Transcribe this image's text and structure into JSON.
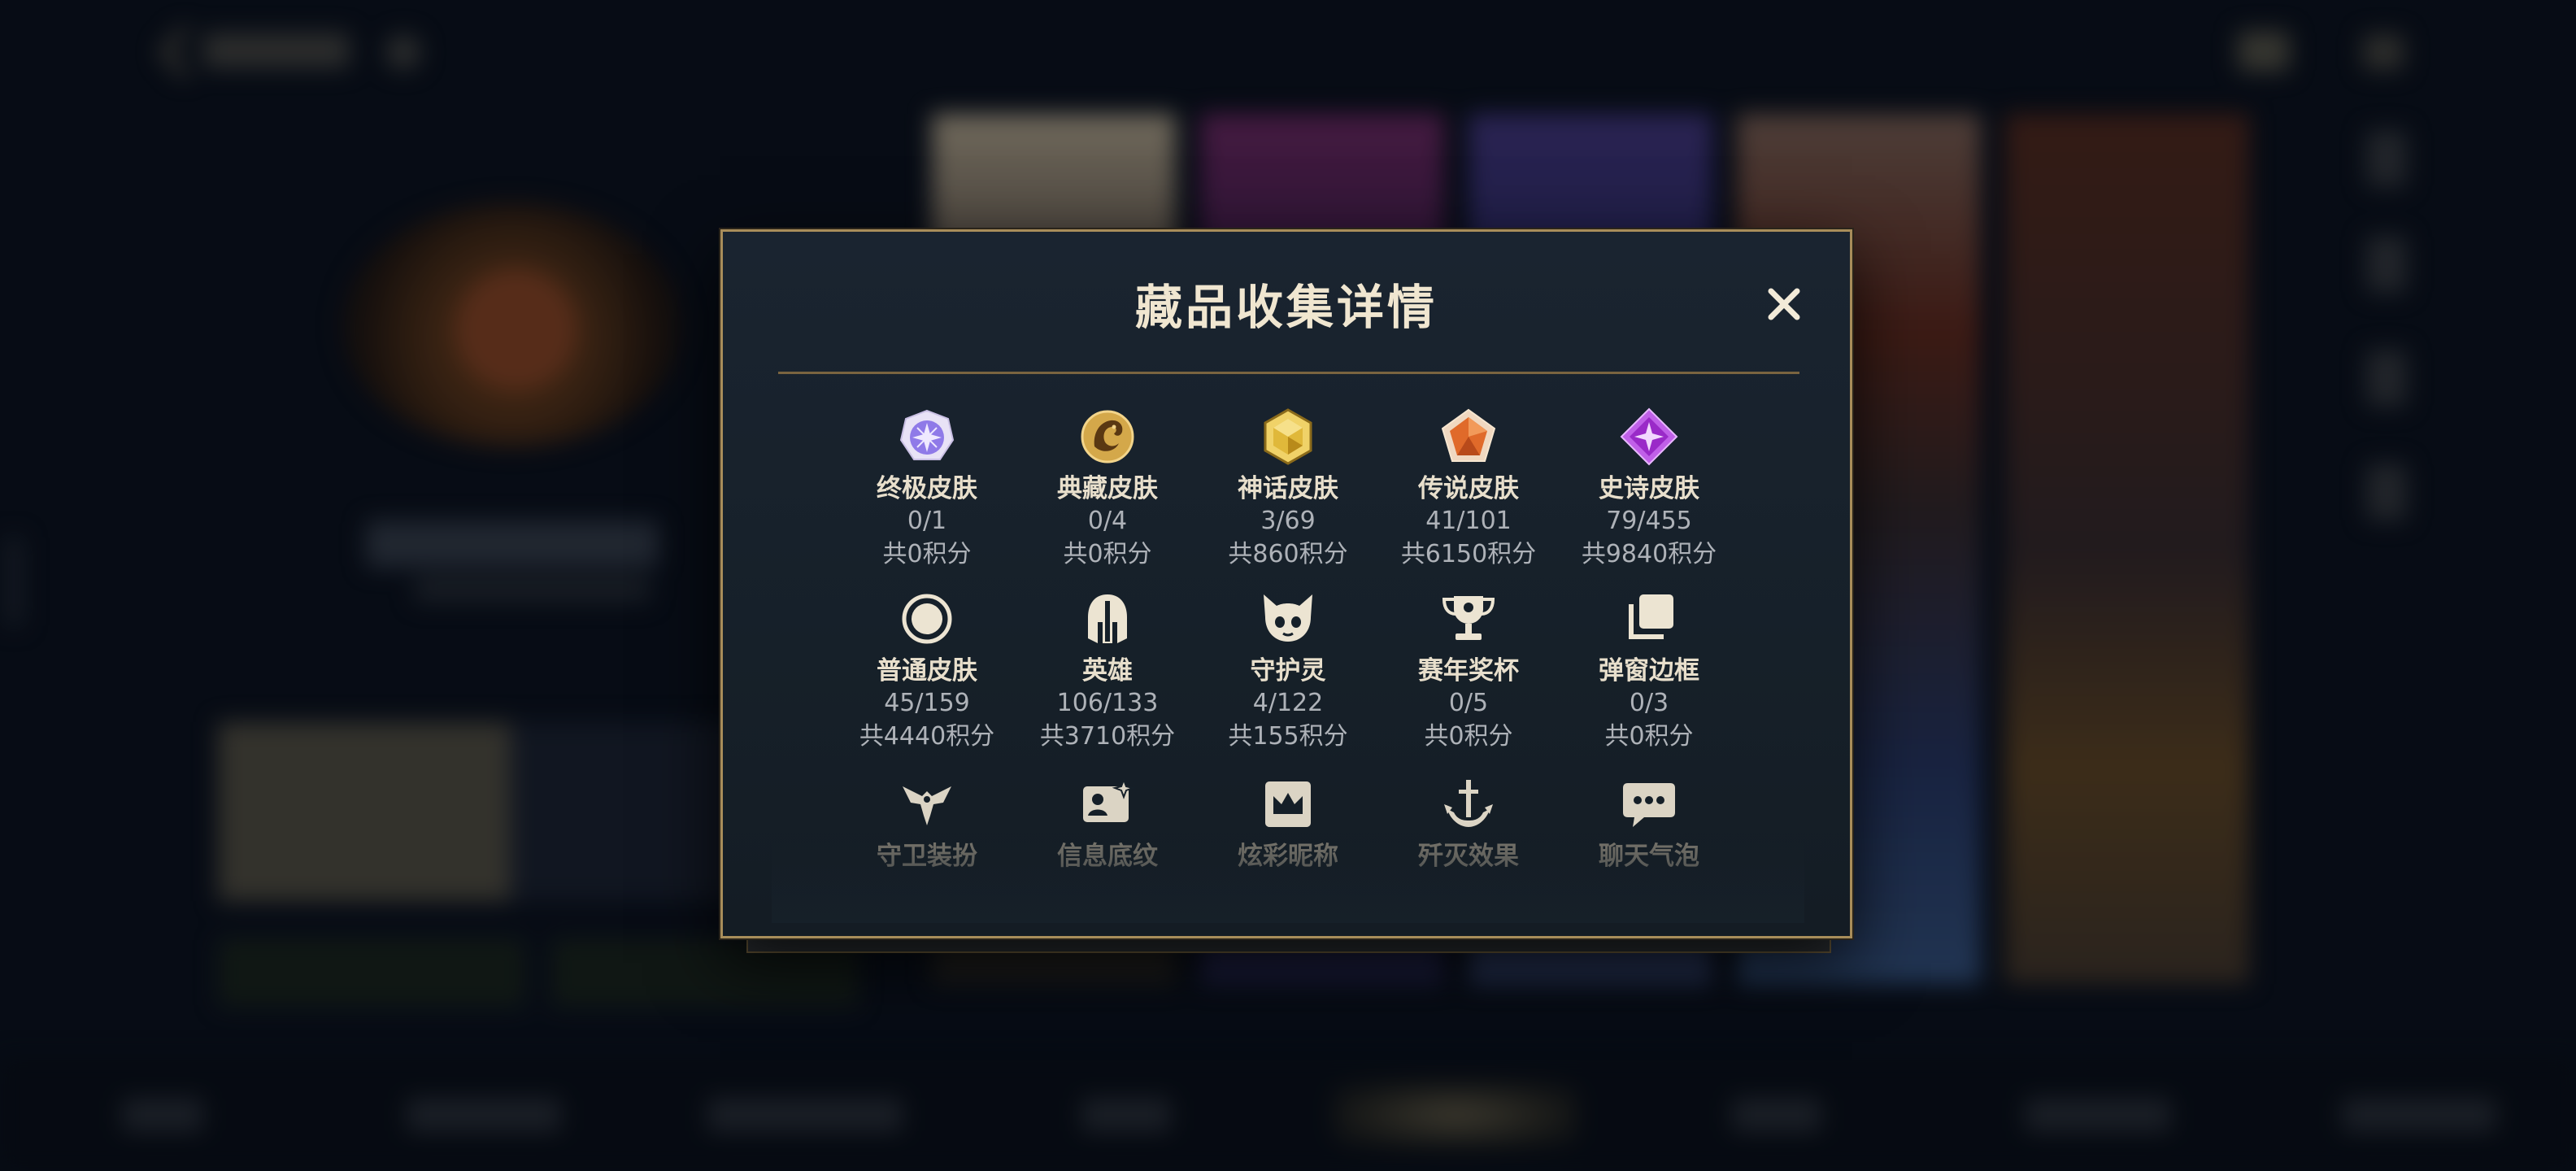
{
  "modal": {
    "title": "藏品收集详情",
    "close_label": "✕"
  },
  "collection_rows": [
    [
      {
        "label": "终极皮肤",
        "count": "0/1",
        "points": "共0积分",
        "icon": "ultimate-skin-icon",
        "color": "#8f7ae8"
      },
      {
        "label": "典藏皮肤",
        "count": "0/4",
        "points": "共0积分",
        "icon": "legacy-skin-icon",
        "color": "#d4a84a"
      },
      {
        "label": "神话皮肤",
        "count": "3/69",
        "points": "共860积分",
        "icon": "mythic-skin-icon",
        "color": "#e0b83a"
      },
      {
        "label": "传说皮肤",
        "count": "41/101",
        "points": "共6150积分",
        "icon": "legendary-skin-icon",
        "color": "#e06a2a"
      },
      {
        "label": "史诗皮肤",
        "count": "79/455",
        "points": "共9840积分",
        "icon": "epic-skin-icon",
        "color": "#b040d8"
      }
    ],
    [
      {
        "label": "普通皮肤",
        "count": "45/159",
        "points": "共4440积分",
        "icon": "normal-skin-icon",
        "color": "#e8dfcc"
      },
      {
        "label": "英雄",
        "count": "106/133",
        "points": "共3710积分",
        "icon": "hero-icon",
        "color": "#e8dfcc"
      },
      {
        "label": "守护灵",
        "count": "4/122",
        "points": "共155积分",
        "icon": "guardian-spirit-icon",
        "color": "#e8dfcc"
      },
      {
        "label": "赛年奖杯",
        "count": "0/5",
        "points": "共0积分",
        "icon": "season-trophy-icon",
        "color": "#e8dfcc"
      },
      {
        "label": "弹窗边框",
        "count": "0/3",
        "points": "共0积分",
        "icon": "popup-frame-icon",
        "color": "#e8dfcc"
      }
    ],
    [
      {
        "label": "守卫装扮",
        "icon": "ward-skin-icon"
      },
      {
        "label": "信息底纹",
        "icon": "info-background-icon"
      },
      {
        "label": "炫彩昵称",
        "icon": "colorful-nickname-icon"
      },
      {
        "label": "歼灭效果",
        "icon": "annihilation-effect-icon"
      },
      {
        "label": "聊天气泡",
        "icon": "chat-bubble-icon"
      }
    ]
  ],
  "colors": {
    "modal_border": "#a88d5a",
    "title_text": "#f0e6d0",
    "secondary_text": "#aeb2b8",
    "faded_text": "#7e7a70"
  }
}
